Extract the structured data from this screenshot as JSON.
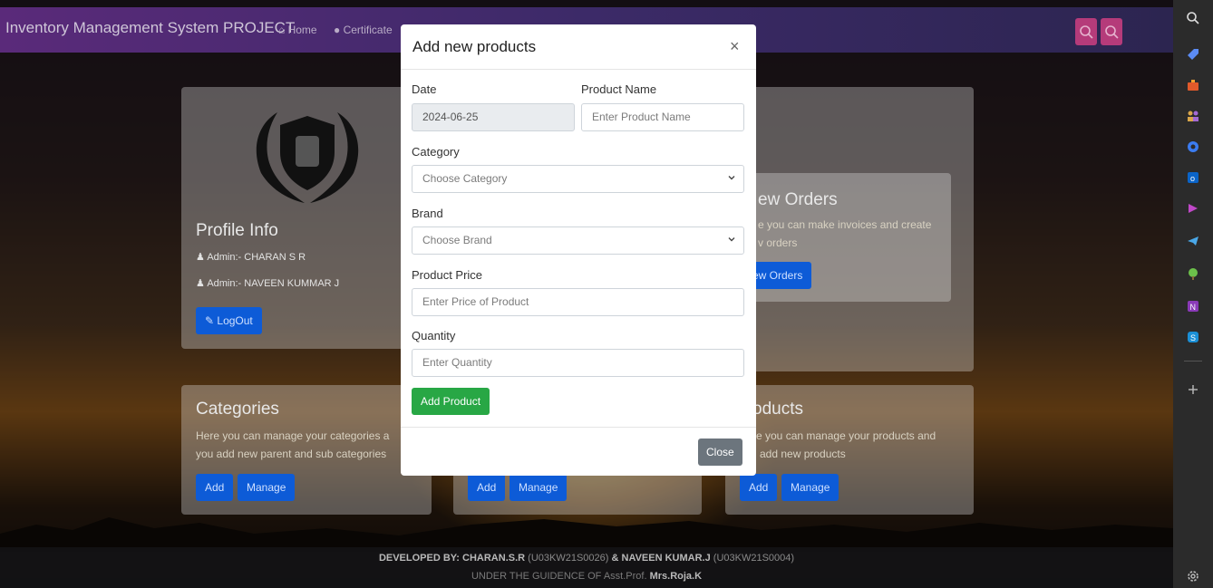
{
  "navbar": {
    "brand": "Inventory Management System PROJECT",
    "home": "Home",
    "certificate": "Certificate"
  },
  "profile": {
    "title": "Profile Info",
    "admin1": "Admin:- CHARAN S R",
    "admin2": "Admin:- NAVEEN KUMMAR J",
    "logout": "LogOut"
  },
  "orders": {
    "title": "ew Orders",
    "text1": "e you can make invoices and create",
    "text2": "v orders",
    "button": "ew Orders"
  },
  "categories": {
    "title": "Categories",
    "text1": "Here you can manage your categories a",
    "text2": "you add new parent and sub categories",
    "add": "Add",
    "manage": "Manage"
  },
  "brands": {
    "add": "Add",
    "manage": "Manage"
  },
  "products": {
    "title": "oducts",
    "text1": "e you can manage your products and",
    "text2": "add new products",
    "add": "Add",
    "manage": "Manage"
  },
  "footer": {
    "dev_label": "DEVELOPED BY:",
    "dev1_name": "CHARAN.S.R",
    "dev1_id": "(U03KW21S0026)",
    "amp": "&",
    "dev2_name": "NAVEEN KUMAR.J",
    "dev2_id": "(U03KW21S0004)",
    "guidance": "UNDER THE GUIDENCE OF Asst.Prof.",
    "guide_name": "Mrs.Roja.K"
  },
  "modal": {
    "title": "Add new products",
    "close_x": "×",
    "date_label": "Date",
    "date_value": "2024-06-25",
    "product_name_label": "Product Name",
    "product_name_placeholder": "Enter Product Name",
    "category_label": "Category",
    "category_selected": "Choose Category",
    "brand_label": "Brand",
    "brand_selected": "Choose Brand",
    "price_label": "Product Price",
    "price_placeholder": "Enter Price of Product",
    "quantity_label": "Quantity",
    "quantity_placeholder": "Enter Quantity",
    "add_button": "Add Product",
    "close_button": "Close"
  },
  "colors": {
    "primary": "#0d5bd7",
    "success": "#28a745",
    "secondary": "#6c757d"
  },
  "sidebar_icons": [
    "search-icon",
    "tag-icon",
    "briefcase-icon",
    "people-icon",
    "copilot-icon",
    "outlook-icon",
    "games-icon",
    "telegram-icon",
    "tree-icon",
    "onenote-icon",
    "skype-icon",
    "add-icon",
    "settings-icon"
  ]
}
